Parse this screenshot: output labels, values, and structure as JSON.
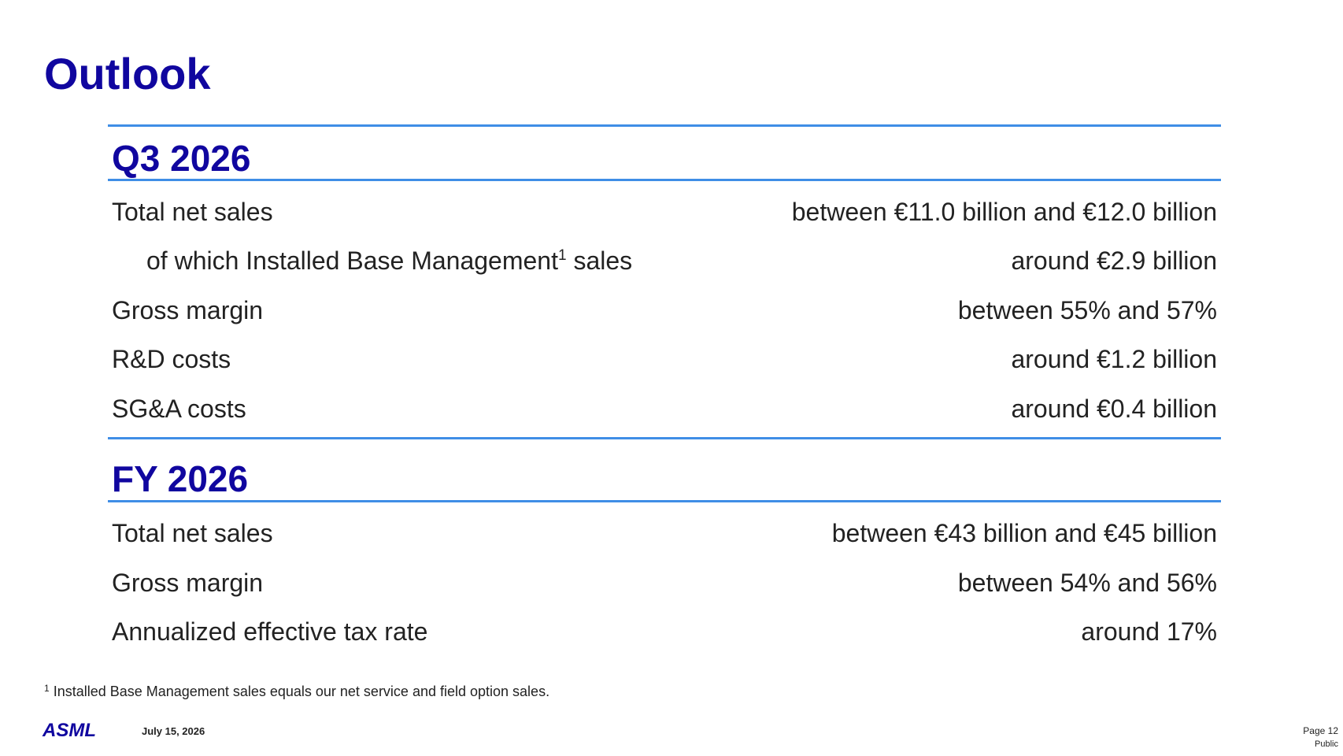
{
  "title": "Outlook",
  "q3": {
    "heading": "Q3 2026",
    "rows": [
      {
        "label": "Total net sales",
        "value": "between €11.0 billion and €12.0 billion"
      },
      {
        "label": "of which Installed Base Management",
        "label_sup": "1",
        "label_suffix": " sales",
        "value": "around €2.9 billion"
      },
      {
        "label": "Gross margin",
        "value": "between 55% and 57%"
      },
      {
        "label": "R&D costs",
        "value": "around €1.2 billion"
      },
      {
        "label": "SG&A costs",
        "value": "around €0.4 billion"
      }
    ]
  },
  "fy": {
    "heading": "FY 2026",
    "rows": [
      {
        "label": "Total net sales",
        "value": "between €43 billion and €45 billion"
      },
      {
        "label": "Gross margin",
        "value": "between 54% and 56%"
      },
      {
        "label": "Annualized effective tax rate",
        "value": "around 17%"
      }
    ]
  },
  "footnote": {
    "marker": "1",
    "text": " Installed Base Management sales equals our net service and field option sales."
  },
  "footer": {
    "logo": "ASML",
    "date": "July 15, 2026",
    "page": "Page 12",
    "classification": "Public"
  },
  "colors": {
    "heading": "#10069f",
    "rule": "#3f8ee6",
    "text": "#222222"
  }
}
